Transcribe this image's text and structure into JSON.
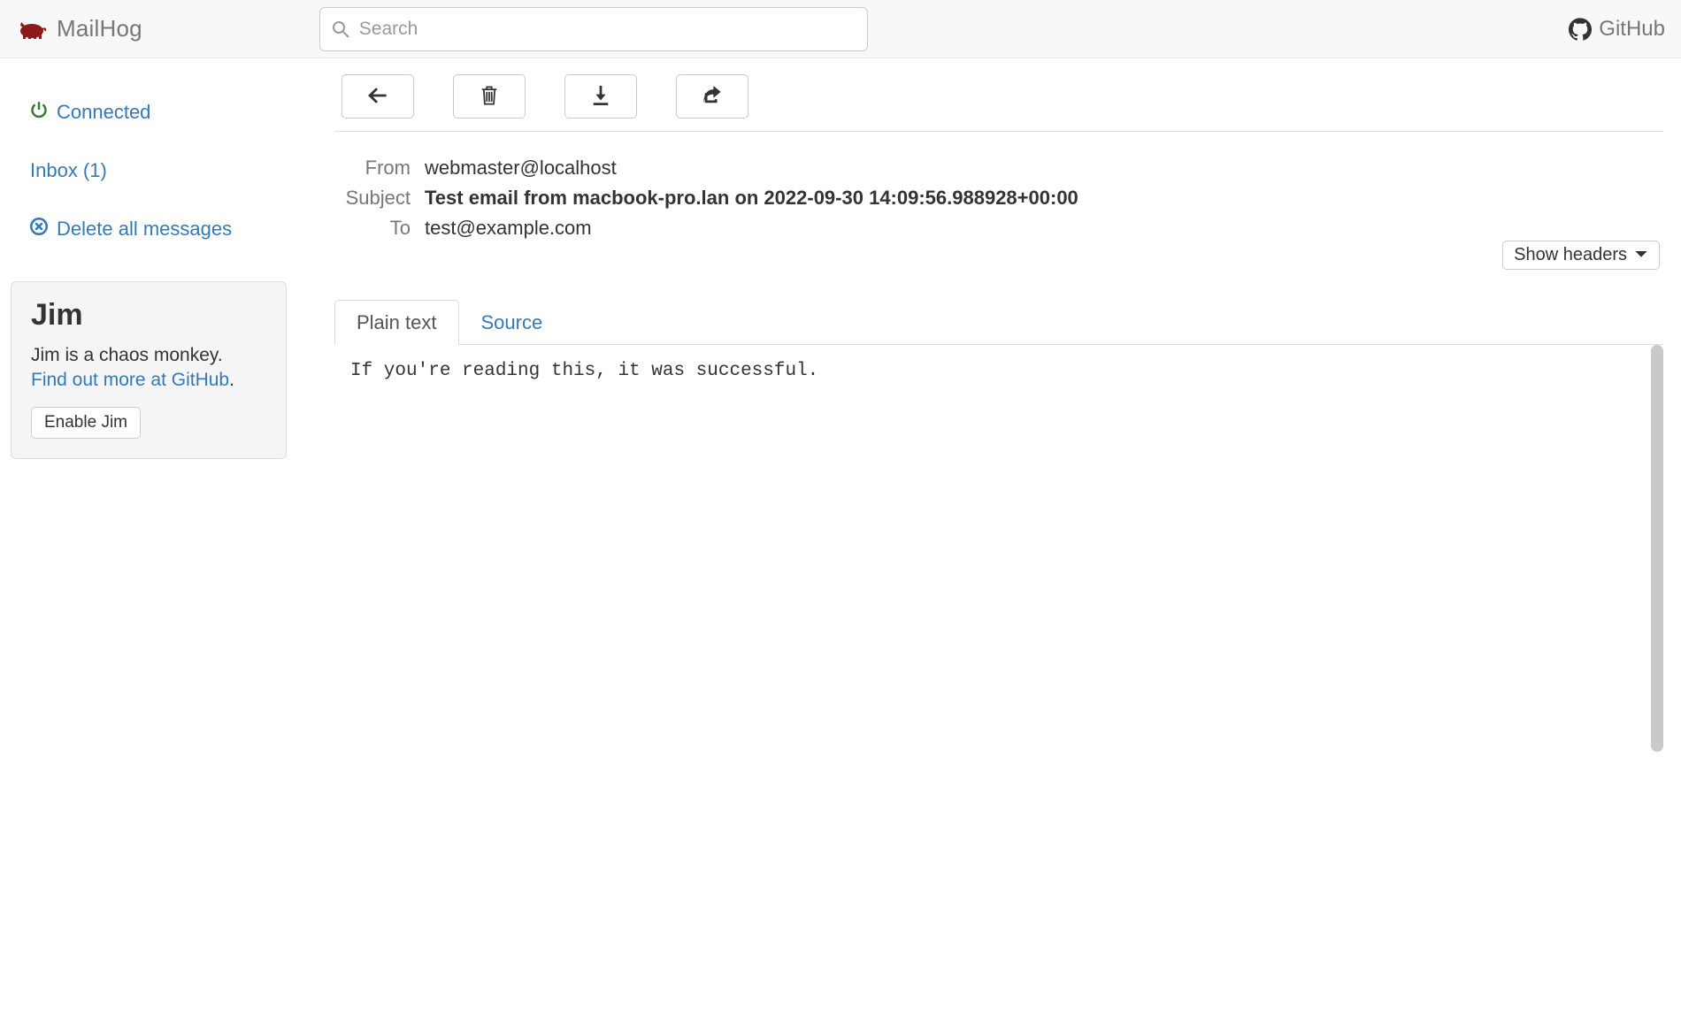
{
  "app": {
    "name": "MailHog"
  },
  "nav": {
    "search_placeholder": "Search",
    "github_label": "GitHub"
  },
  "sidebar": {
    "connected_label": "Connected",
    "inbox_label": "Inbox (1)",
    "delete_all_label": "Delete all messages",
    "jim": {
      "title": "Jim",
      "desc": "Jim is a chaos monkey.",
      "link_text": "Find out more at GitHub",
      "link_suffix": ".",
      "enable_label": "Enable Jim"
    }
  },
  "message": {
    "labels": {
      "from": "From",
      "subject": "Subject",
      "to": "To"
    },
    "from": "webmaster@localhost",
    "subject": "Test email from macbook-pro.lan on 2022-09-30 14:09:56.988928+00:00",
    "to": "test@example.com",
    "show_headers_label": "Show headers",
    "tabs": {
      "plain": "Plain text",
      "source": "Source"
    },
    "body": "If you're reading this, it was successful."
  }
}
